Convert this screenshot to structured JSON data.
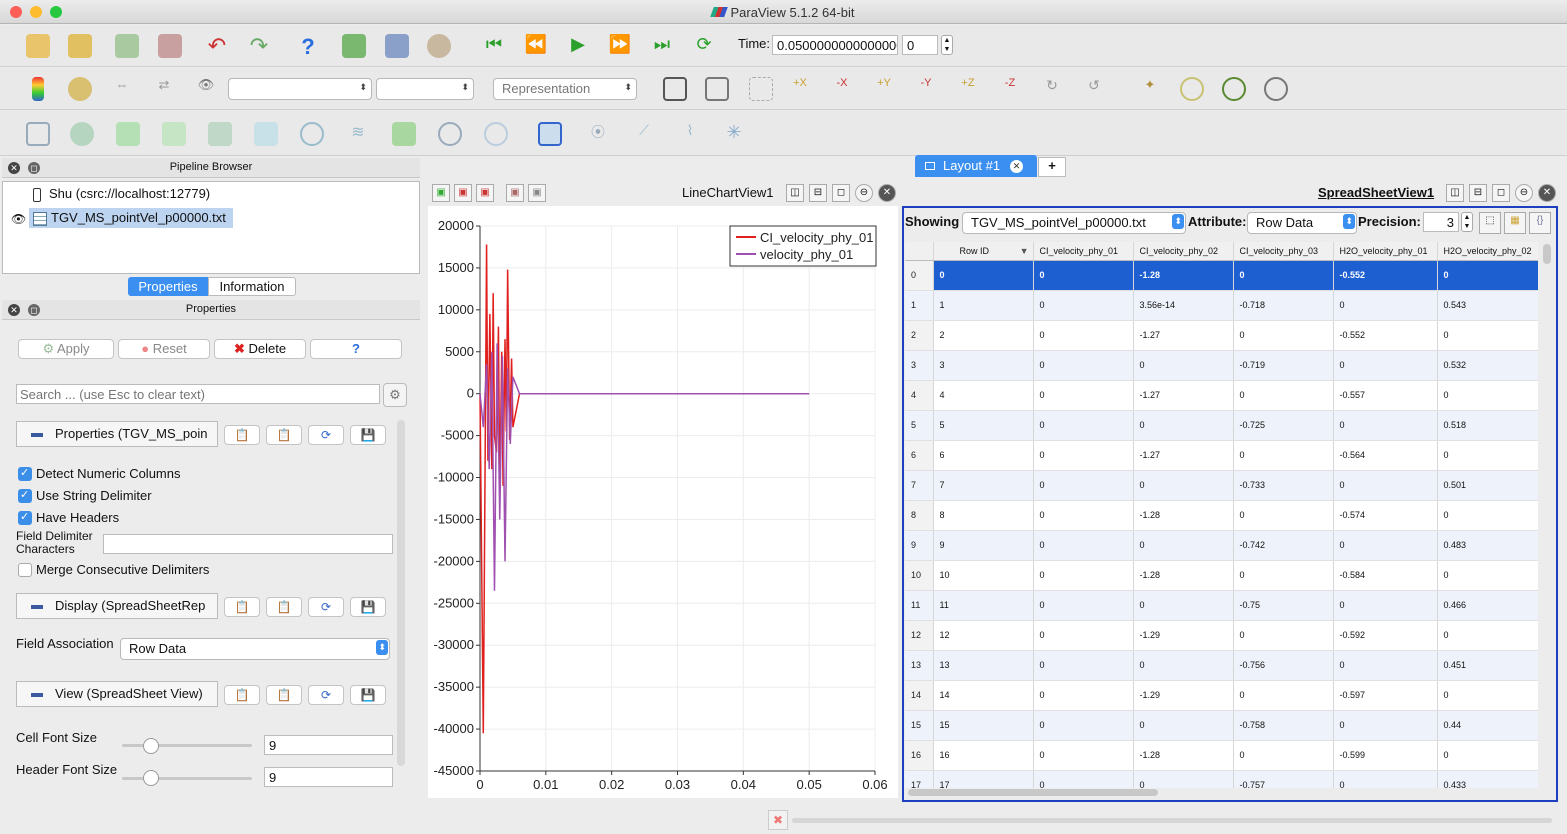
{
  "window": {
    "title": "ParaView 5.1.2 64-bit"
  },
  "toolbar": {
    "time_label": "Time:",
    "time_value": "0.0500000000000000",
    "timestep_value": "0",
    "combo1": "",
    "combo2": "",
    "representation": "Representation"
  },
  "pipeline": {
    "title": "Pipeline Browser",
    "server": "Shu (csrc://localhost:12779)",
    "source": "TGV_MS_pointVel_p00000.txt"
  },
  "tabs": {
    "properties": "Properties",
    "information": "Information"
  },
  "properties": {
    "title": "Properties",
    "apply": "Apply",
    "reset": "Reset",
    "delete": "Delete",
    "help": "?",
    "search_placeholder": "Search ... (use Esc to clear text)",
    "section1": "Properties (TGV_MS_poin",
    "detect_numeric": "Detect Numeric Columns",
    "string_delim": "Use String Delimiter",
    "have_headers": "Have Headers",
    "field_delim": "Field Delimiter Characters",
    "field_delim_value": "",
    "merge_delims": "Merge Consecutive Delimiters",
    "section2": "Display (SpreadSheetRep",
    "field_assoc_label": "Field Association",
    "field_assoc_value": "Row Data",
    "section3": "View (SpreadSheet View)",
    "cell_font_label": "Cell Font Size",
    "cell_font_value": "9",
    "header_font_label": "Header Font Size",
    "header_font_value": "9"
  },
  "layout": {
    "tab": "Layout #1",
    "add": "+"
  },
  "linechart": {
    "title": "LineChartView1"
  },
  "chart_data": {
    "type": "line",
    "xlim": [
      0,
      0.06
    ],
    "ylim": [
      -45000,
      20000
    ],
    "xticks": [
      "0",
      "0.01",
      "0.02",
      "0.03",
      "0.04",
      "0.05",
      "0.06"
    ],
    "yticks": [
      "20000",
      "15000",
      "10000",
      "5000",
      "0",
      "-5000",
      "-10000",
      "-15000",
      "-20000",
      "-25000",
      "-30000",
      "-35000",
      "-40000",
      "-45000"
    ],
    "legend_position": "top-right",
    "series": [
      {
        "name": "CI_velocity_phy_01",
        "color": "#e0201e",
        "x": [
          0,
          0.0005,
          0.001,
          0.0012,
          0.0015,
          0.0018,
          0.002,
          0.0022,
          0.0025,
          0.0028,
          0.003,
          0.0033,
          0.0035,
          0.0038,
          0.004,
          0.0042,
          0.0045,
          0.0048,
          0.005,
          0.006,
          0.05
        ],
        "y": [
          0,
          -40500,
          17800,
          -8000,
          9500,
          -9000,
          12000,
          -5000,
          -7000,
          8000,
          -12000,
          5000,
          -11000,
          6500,
          -4500,
          14800,
          -5500,
          4200,
          -4000,
          0,
          0
        ]
      },
      {
        "name": "velocity_phy_01",
        "color": "#a050b0",
        "x": [
          0,
          0.0005,
          0.001,
          0.0014,
          0.0018,
          0.0022,
          0.0026,
          0.003,
          0.0034,
          0.0038,
          0.0042,
          0.0046,
          0.005,
          0.006,
          0.05
        ],
        "y": [
          0,
          -4000,
          3500,
          -9000,
          5000,
          -23500,
          6000,
          -15000,
          4500,
          -20000,
          3000,
          -6000,
          2000,
          0,
          0
        ]
      }
    ]
  },
  "spreadsheet": {
    "title": "SpreadSheetView1",
    "showing_label": "Showing",
    "source": "TGV_MS_pointVel_p00000.txt",
    "attribute_label": "Attribute:",
    "attribute_value": "Row Data",
    "precision_label": "Precision:",
    "precision_value": "3",
    "columns": [
      "",
      "Row ID",
      "CI_velocity_phy_01",
      "CI_velocity_phy_02",
      "CI_velocity_phy_03",
      "H2O_velocity_phy_01",
      "H2O_velocity_phy_02"
    ],
    "rows": [
      [
        "0",
        "0",
        "0",
        "-1.28",
        "0",
        "-0.552",
        "0"
      ],
      [
        "1",
        "1",
        "0",
        "3.56e-14",
        "-0.718",
        "0",
        "0.543"
      ],
      [
        "2",
        "2",
        "0",
        "-1.27",
        "0",
        "-0.552",
        "0"
      ],
      [
        "3",
        "3",
        "0",
        "0",
        "-0.719",
        "0",
        "0.532"
      ],
      [
        "4",
        "4",
        "0",
        "-1.27",
        "0",
        "-0.557",
        "0"
      ],
      [
        "5",
        "5",
        "0",
        "0",
        "-0.725",
        "0",
        "0.518"
      ],
      [
        "6",
        "6",
        "0",
        "-1.27",
        "0",
        "-0.564",
        "0"
      ],
      [
        "7",
        "7",
        "0",
        "0",
        "-0.733",
        "0",
        "0.501"
      ],
      [
        "8",
        "8",
        "0",
        "-1.28",
        "0",
        "-0.574",
        "0"
      ],
      [
        "9",
        "9",
        "0",
        "0",
        "-0.742",
        "0",
        "0.483"
      ],
      [
        "10",
        "10",
        "0",
        "-1.28",
        "0",
        "-0.584",
        "0"
      ],
      [
        "11",
        "11",
        "0",
        "0",
        "-0.75",
        "0",
        "0.466"
      ],
      [
        "12",
        "12",
        "0",
        "-1.29",
        "0",
        "-0.592",
        "0"
      ],
      [
        "13",
        "13",
        "0",
        "0",
        "-0.756",
        "0",
        "0.451"
      ],
      [
        "14",
        "14",
        "0",
        "-1.29",
        "0",
        "-0.597",
        "0"
      ],
      [
        "15",
        "15",
        "0",
        "0",
        "-0.758",
        "0",
        "0.44"
      ],
      [
        "16",
        "16",
        "0",
        "-1.28",
        "0",
        "-0.599",
        "0"
      ],
      [
        "17",
        "17",
        "0",
        "0",
        "-0.757",
        "0",
        "0.433"
      ]
    ]
  }
}
